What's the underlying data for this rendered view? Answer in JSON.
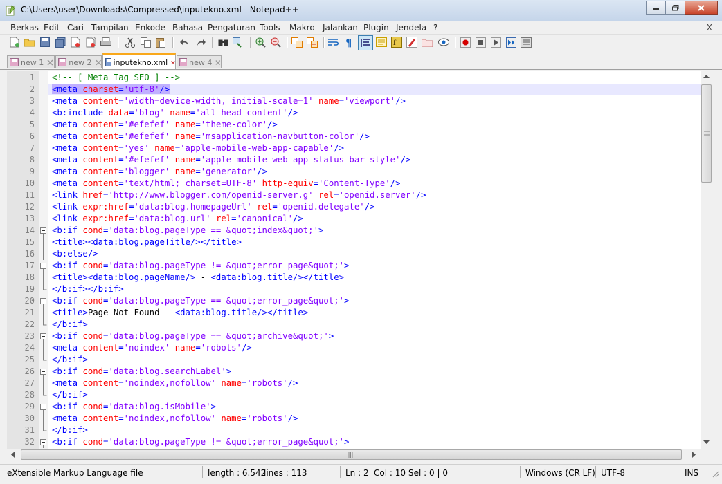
{
  "window": {
    "title": "C:\\Users\\user\\Downloads\\Compressed\\inputekno.xml - Notepad++"
  },
  "menu": {
    "items": [
      "Berkas",
      "Edit",
      "Cari",
      "Tampilan",
      "Enkode",
      "Bahasa",
      "Pengaturan",
      "Tools",
      "Makro",
      "Jalankan",
      "Plugin",
      "Jendela",
      "?"
    ],
    "close": "X"
  },
  "tabs": [
    {
      "label": "new 1",
      "active": false
    },
    {
      "label": "new 2",
      "active": false
    },
    {
      "label": "inputekno.xml",
      "active": true
    },
    {
      "label": "new 4",
      "active": false
    }
  ],
  "editor": {
    "current_line": 2,
    "lines": [
      {
        "n": "1",
        "parts": [
          [
            "com",
            "<!-- [ Meta Tag SEO ] -->"
          ]
        ]
      },
      {
        "n": "2",
        "parts": [
          [
            "tag",
            "<meta "
          ],
          [
            "attr",
            "charset"
          ],
          [
            "tag",
            "="
          ],
          [
            "val",
            "'utf-8'"
          ],
          [
            "tag",
            "/>"
          ]
        ]
      },
      {
        "n": "3",
        "parts": [
          [
            "tag",
            "<meta "
          ],
          [
            "attr",
            "content"
          ],
          [
            "tag",
            "="
          ],
          [
            "val",
            "'width=device-width, initial-scale=1'"
          ],
          [
            "tag",
            " "
          ],
          [
            "attr",
            "name"
          ],
          [
            "tag",
            "="
          ],
          [
            "val",
            "'viewport'"
          ],
          [
            "tag",
            "/>"
          ]
        ]
      },
      {
        "n": "4",
        "parts": [
          [
            "tag",
            "<b:include "
          ],
          [
            "attr",
            "data"
          ],
          [
            "tag",
            "="
          ],
          [
            "val",
            "'blog'"
          ],
          [
            "tag",
            " "
          ],
          [
            "attr",
            "name"
          ],
          [
            "tag",
            "="
          ],
          [
            "val",
            "'all-head-content'"
          ],
          [
            "tag",
            "/>"
          ]
        ]
      },
      {
        "n": "5",
        "parts": [
          [
            "tag",
            "<meta "
          ],
          [
            "attr",
            "content"
          ],
          [
            "tag",
            "="
          ],
          [
            "val",
            "'#efefef'"
          ],
          [
            "tag",
            " "
          ],
          [
            "attr",
            "name"
          ],
          [
            "tag",
            "="
          ],
          [
            "val",
            "'theme-color'"
          ],
          [
            "tag",
            "/>"
          ]
        ]
      },
      {
        "n": "6",
        "parts": [
          [
            "tag",
            "<meta "
          ],
          [
            "attr",
            "content"
          ],
          [
            "tag",
            "="
          ],
          [
            "val",
            "'#efefef'"
          ],
          [
            "tag",
            " "
          ],
          [
            "attr",
            "name"
          ],
          [
            "tag",
            "="
          ],
          [
            "val",
            "'msapplication-navbutton-color'"
          ],
          [
            "tag",
            "/>"
          ]
        ]
      },
      {
        "n": "7",
        "parts": [
          [
            "tag",
            "<meta "
          ],
          [
            "attr",
            "content"
          ],
          [
            "tag",
            "="
          ],
          [
            "val",
            "'yes'"
          ],
          [
            "tag",
            " "
          ],
          [
            "attr",
            "name"
          ],
          [
            "tag",
            "="
          ],
          [
            "val",
            "'apple-mobile-web-app-capable'"
          ],
          [
            "tag",
            "/>"
          ]
        ]
      },
      {
        "n": "8",
        "parts": [
          [
            "tag",
            "<meta "
          ],
          [
            "attr",
            "content"
          ],
          [
            "tag",
            "="
          ],
          [
            "val",
            "'#efefef'"
          ],
          [
            "tag",
            " "
          ],
          [
            "attr",
            "name"
          ],
          [
            "tag",
            "="
          ],
          [
            "val",
            "'apple-mobile-web-app-status-bar-style'"
          ],
          [
            "tag",
            "/>"
          ]
        ]
      },
      {
        "n": "9",
        "parts": [
          [
            "tag",
            "<meta "
          ],
          [
            "attr",
            "content"
          ],
          [
            "tag",
            "="
          ],
          [
            "val",
            "'blogger'"
          ],
          [
            "tag",
            " "
          ],
          [
            "attr",
            "name"
          ],
          [
            "tag",
            "="
          ],
          [
            "val",
            "'generator'"
          ],
          [
            "tag",
            "/>"
          ]
        ]
      },
      {
        "n": "10",
        "parts": [
          [
            "tag",
            "<meta "
          ],
          [
            "attr",
            "content"
          ],
          [
            "tag",
            "="
          ],
          [
            "val",
            "'text/html; charset=UTF-8'"
          ],
          [
            "tag",
            " "
          ],
          [
            "attr",
            "http-equiv"
          ],
          [
            "tag",
            "="
          ],
          [
            "val",
            "'Content-Type'"
          ],
          [
            "tag",
            "/>"
          ]
        ]
      },
      {
        "n": "11",
        "parts": [
          [
            "tag",
            "<link "
          ],
          [
            "attr",
            "href"
          ],
          [
            "tag",
            "="
          ],
          [
            "val",
            "'http://www.blogger.com/openid-server.g'"
          ],
          [
            "tag",
            " "
          ],
          [
            "attr",
            "rel"
          ],
          [
            "tag",
            "="
          ],
          [
            "val",
            "'openid.server'"
          ],
          [
            "tag",
            "/>"
          ]
        ]
      },
      {
        "n": "12",
        "parts": [
          [
            "tag",
            "<link "
          ],
          [
            "attr",
            "expr:href"
          ],
          [
            "tag",
            "="
          ],
          [
            "val",
            "'data:blog.homepageUrl'"
          ],
          [
            "tag",
            " "
          ],
          [
            "attr",
            "rel"
          ],
          [
            "tag",
            "="
          ],
          [
            "val",
            "'openid.delegate'"
          ],
          [
            "tag",
            "/>"
          ]
        ]
      },
      {
        "n": "13",
        "parts": [
          [
            "tag",
            "<link "
          ],
          [
            "attr",
            "expr:href"
          ],
          [
            "tag",
            "="
          ],
          [
            "val",
            "'data:blog.url'"
          ],
          [
            "tag",
            " "
          ],
          [
            "attr",
            "rel"
          ],
          [
            "tag",
            "="
          ],
          [
            "val",
            "'canonical'"
          ],
          [
            "tag",
            "/>"
          ]
        ]
      },
      {
        "n": "14",
        "fold": "open",
        "parts": [
          [
            "tag",
            "<b:if "
          ],
          [
            "attr",
            "cond"
          ],
          [
            "tag",
            "="
          ],
          [
            "val",
            "'data:blog.pageType == &quot;index&quot;'"
          ],
          [
            "tag",
            ">"
          ]
        ]
      },
      {
        "n": "15",
        "fold": "line",
        "parts": [
          [
            "tag",
            "<title><data:blog.pageTitle/></title>"
          ]
        ]
      },
      {
        "n": "16",
        "fold": "line",
        "parts": [
          [
            "tag",
            "<b:else/>"
          ]
        ]
      },
      {
        "n": "17",
        "fold": "open",
        "parts": [
          [
            "tag",
            "<b:if "
          ],
          [
            "attr",
            "cond"
          ],
          [
            "tag",
            "="
          ],
          [
            "val",
            "'data:blog.pageType != &quot;error_page&quot;'"
          ],
          [
            "tag",
            ">"
          ]
        ]
      },
      {
        "n": "18",
        "fold": "line",
        "parts": [
          [
            "tag",
            "<title><data:blog.pageName/>"
          ],
          [
            "txt",
            " - "
          ],
          [
            "tag",
            "<data:blog.title/></title>"
          ]
        ]
      },
      {
        "n": "19",
        "fold": "end",
        "parts": [
          [
            "tag",
            "</b:if></b:if>"
          ]
        ]
      },
      {
        "n": "20",
        "fold": "open",
        "parts": [
          [
            "tag",
            "<b:if "
          ],
          [
            "attr",
            "cond"
          ],
          [
            "tag",
            "="
          ],
          [
            "val",
            "'data:blog.pageType == &quot;error_page&quot;'"
          ],
          [
            "tag",
            ">"
          ]
        ]
      },
      {
        "n": "21",
        "fold": "line",
        "parts": [
          [
            "tag",
            "<title>"
          ],
          [
            "txt",
            "Page Not Found - "
          ],
          [
            "tag",
            "<data:blog.title/></title>"
          ]
        ]
      },
      {
        "n": "22",
        "fold": "end",
        "parts": [
          [
            "tag",
            "</b:if>"
          ]
        ]
      },
      {
        "n": "23",
        "fold": "open",
        "parts": [
          [
            "tag",
            "<b:if "
          ],
          [
            "attr",
            "cond"
          ],
          [
            "tag",
            "="
          ],
          [
            "val",
            "'data:blog.pageType == &quot;archive&quot;'"
          ],
          [
            "tag",
            ">"
          ]
        ]
      },
      {
        "n": "24",
        "fold": "line",
        "parts": [
          [
            "tag",
            "<meta "
          ],
          [
            "attr",
            "content"
          ],
          [
            "tag",
            "="
          ],
          [
            "val",
            "'noindex'"
          ],
          [
            "tag",
            " "
          ],
          [
            "attr",
            "name"
          ],
          [
            "tag",
            "="
          ],
          [
            "val",
            "'robots'"
          ],
          [
            "tag",
            "/>"
          ]
        ]
      },
      {
        "n": "25",
        "fold": "end",
        "parts": [
          [
            "tag",
            "</b:if>"
          ]
        ]
      },
      {
        "n": "26",
        "fold": "open",
        "parts": [
          [
            "tag",
            "<b:if "
          ],
          [
            "attr",
            "cond"
          ],
          [
            "tag",
            "="
          ],
          [
            "val",
            "'data:blog.searchLabel'"
          ],
          [
            "tag",
            ">"
          ]
        ]
      },
      {
        "n": "27",
        "fold": "line",
        "parts": [
          [
            "tag",
            "<meta "
          ],
          [
            "attr",
            "content"
          ],
          [
            "tag",
            "="
          ],
          [
            "val",
            "'noindex,nofollow'"
          ],
          [
            "tag",
            " "
          ],
          [
            "attr",
            "name"
          ],
          [
            "tag",
            "="
          ],
          [
            "val",
            "'robots'"
          ],
          [
            "tag",
            "/>"
          ]
        ]
      },
      {
        "n": "28",
        "fold": "end",
        "parts": [
          [
            "tag",
            "</b:if>"
          ]
        ]
      },
      {
        "n": "29",
        "fold": "open",
        "parts": [
          [
            "tag",
            "<b:if "
          ],
          [
            "attr",
            "cond"
          ],
          [
            "tag",
            "="
          ],
          [
            "val",
            "'data:blog.isMobile'"
          ],
          [
            "tag",
            ">"
          ]
        ]
      },
      {
        "n": "30",
        "fold": "line",
        "parts": [
          [
            "tag",
            "<meta "
          ],
          [
            "attr",
            "content"
          ],
          [
            "tag",
            "="
          ],
          [
            "val",
            "'noindex,nofollow'"
          ],
          [
            "tag",
            " "
          ],
          [
            "attr",
            "name"
          ],
          [
            "tag",
            "="
          ],
          [
            "val",
            "'robots'"
          ],
          [
            "tag",
            "/>"
          ]
        ]
      },
      {
        "n": "31",
        "fold": "end",
        "parts": [
          [
            "tag",
            "</b:if>"
          ]
        ]
      },
      {
        "n": "32",
        "fold": "open",
        "parts": [
          [
            "tag",
            "<b:if "
          ],
          [
            "attr",
            "cond"
          ],
          [
            "tag",
            "="
          ],
          [
            "val",
            "'data:blog.pageType != &quot;error_page&quot;'"
          ],
          [
            "tag",
            ">"
          ]
        ]
      }
    ]
  },
  "status": {
    "file_type": "eXtensible Markup Language file",
    "length": "length : 6.542",
    "lines": "lines : 113",
    "ln": "Ln : 2",
    "col": "Col : 10",
    "sel": "Sel : 0 | 0",
    "eol": "Windows (CR LF)",
    "encoding": "UTF-8",
    "mode": "INS"
  },
  "colors": {
    "tag": "#0000ff",
    "attr": "#ff0000",
    "value": "#8000ff",
    "comment": "#008000",
    "active_tab_accent": "#f9a81b",
    "current_line": "#e8e8ff"
  },
  "toolbar_icons": [
    "new-file-icon",
    "open-file-icon",
    "save-icon",
    "save-all-icon",
    "close-icon",
    "close-all-icon",
    "print-icon",
    "cut-icon",
    "copy-icon",
    "paste-icon",
    "undo-icon",
    "redo-icon",
    "find-icon",
    "replace-icon",
    "zoom-in-icon",
    "zoom-out-icon",
    "sync-vertical-icon",
    "sync-horizontal-icon",
    "word-wrap-icon",
    "show-all-chars-icon",
    "indent-guide-icon",
    "document-map-icon",
    "function-list-icon",
    "udl-icon",
    "folder-workspace-icon",
    "monitor-icon",
    "record-macro-icon",
    "stop-macro-icon",
    "play-macro-icon",
    "run-macro-multiple-icon",
    "save-macro-icon"
  ]
}
